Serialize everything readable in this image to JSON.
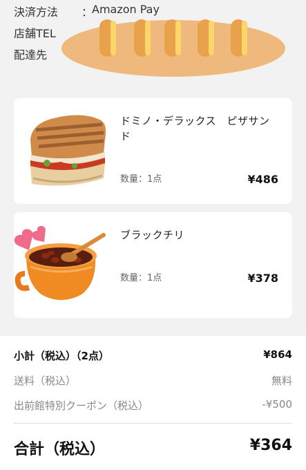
{
  "order_info": {
    "payment_label": "決済方法",
    "colon": "：",
    "payment_value": "Amazon Pay",
    "tel_label": "店舗TEL",
    "address_label": "配達先"
  },
  "items": [
    {
      "name": "ドミノ・デラックス　ピザサンド",
      "qty": "数量：1点",
      "price": "¥486"
    },
    {
      "name": "ブラックチリ",
      "qty": "数量：1点",
      "price": "¥378"
    }
  ],
  "summary": {
    "subtotal_label": "小計（税込）（2点）",
    "subtotal_value": "¥864",
    "shipping_label": "送料（税込）",
    "shipping_value": "無料",
    "coupon_label": "出前館特別クーポン（税込）",
    "coupon_value": "-¥500",
    "total_label": "合計（税込）",
    "total_value": "¥364"
  },
  "colors": {
    "background": "#f2f2f2",
    "bread": "#efb97e",
    "bread_slit": "#fcd66a",
    "heart": "#f06b8b"
  }
}
